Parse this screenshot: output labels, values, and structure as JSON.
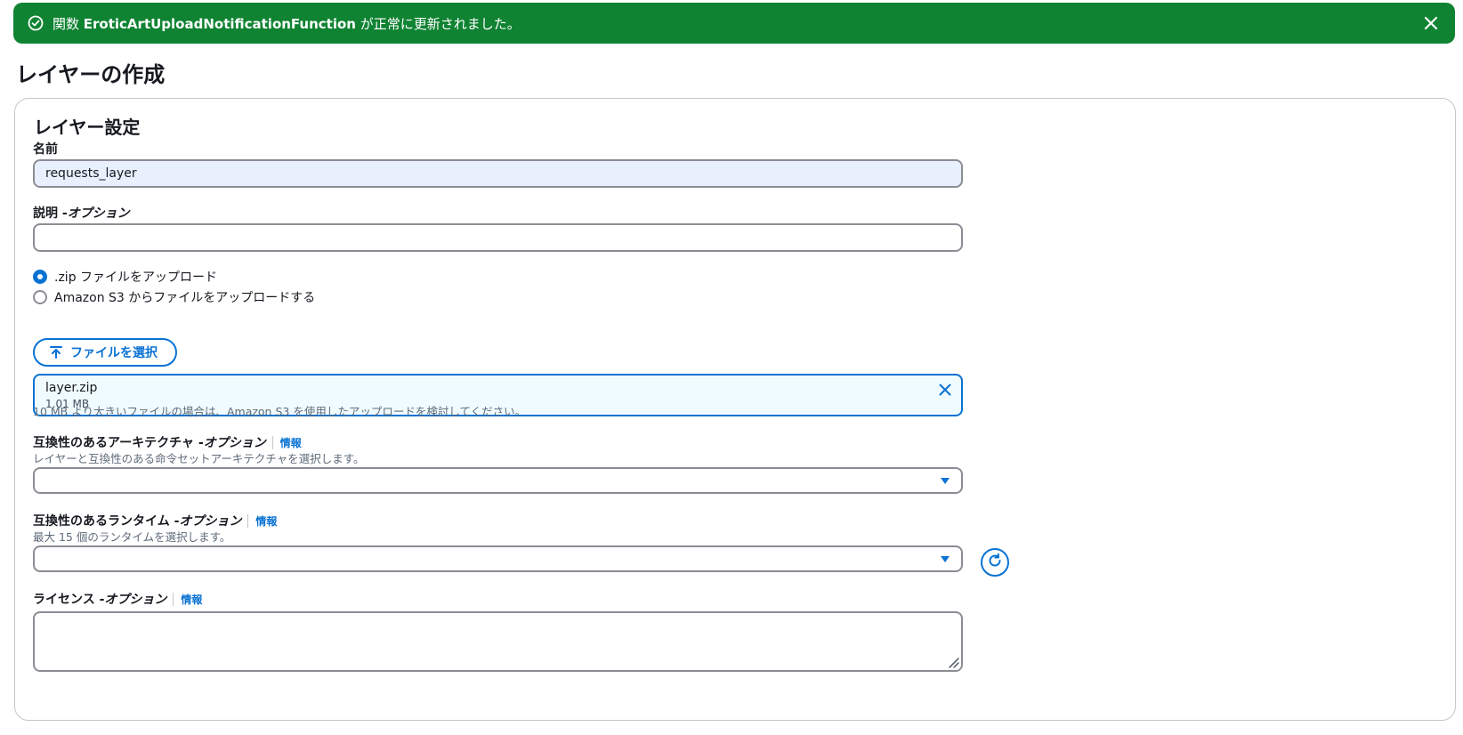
{
  "flash": {
    "prefix": "関数 ",
    "function_name": "EroticArtUploadNotificationFunction",
    "suffix": " が正常に更新されました。",
    "color": "#0f8332"
  },
  "page": {
    "title": "レイヤーの作成"
  },
  "layer_settings": {
    "title": "レイヤー設定",
    "name": {
      "label": "名前",
      "value": "requests_layer"
    },
    "description": {
      "label": "説明 - ",
      "optional": "オプション",
      "value": ""
    },
    "upload_options": [
      {
        "label": ".zip ファイルをアップロード",
        "selected": true
      },
      {
        "label": "Amazon S3 からファイルをアップロードする",
        "selected": false
      }
    ],
    "choose_file_button": "ファイルを選択",
    "file": {
      "name": "layer.zip",
      "size": "1.01 MB"
    },
    "file_hint": "10 MB より大きいファイルの場合は、Amazon S3 を使用したアップロードを検討してください。",
    "architectures": {
      "label": "互換性のあるアーキテクチャ - ",
      "optional": "オプション",
      "info": "情報",
      "description": "レイヤーと互換性のある命令セットアーキテクチャを選択します。",
      "value": ""
    },
    "runtimes": {
      "label": "互換性のあるランタイム - ",
      "optional": "オプション",
      "info": "情報",
      "description": "最大 15 個のランタイムを選択します。",
      "value": ""
    },
    "license": {
      "label": "ライセンス - ",
      "optional": "オプション",
      "info": "情報",
      "value": ""
    }
  },
  "colors": {
    "accent": "#0972d3",
    "success": "#0f8332"
  },
  "icons": [
    "check-circle-icon",
    "close-icon",
    "upload-icon",
    "remove-file-icon",
    "caret-down-icon",
    "refresh-icon",
    "resize-handle-icon"
  ]
}
